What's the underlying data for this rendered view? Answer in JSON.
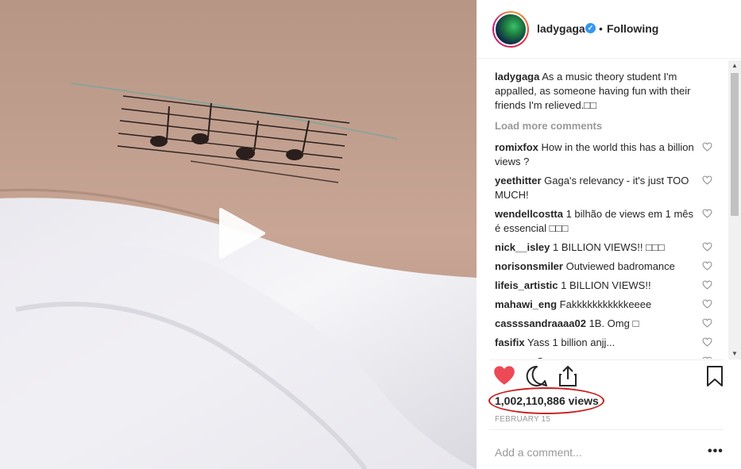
{
  "post": {
    "username": "ladygaga",
    "follow_status": "Following",
    "separator": "•",
    "verified_glyph": "✓",
    "caption_user": "ladygaga",
    "caption_text": "As a music theory student I'm appalled, as someone having fun with their friends I'm relieved.□□",
    "load_more": "Load more comments",
    "comments": [
      {
        "user": "romixfox",
        "text": "How in the world this has a billion views ?"
      },
      {
        "user": "yeethitter",
        "text": "Gaga's relevancy - it's just TOO MUCH!"
      },
      {
        "user": "wendellcostta",
        "text": "1 bilhão de views em 1 mês é essencial □□□"
      },
      {
        "user": "nick__isley",
        "text": "1 BILLION VIEWS!! □□□"
      },
      {
        "user": "norisonsmiler",
        "text": "Outviewed badromance"
      },
      {
        "user": "lifeis_artistic",
        "text": "1 BILLION VIEWS!!"
      },
      {
        "user": "mahawi_eng",
        "text": "Fakkkkkkkkkkkeeee"
      },
      {
        "user": "cassssandraaaa02",
        "text": "1B. Omg □"
      },
      {
        "user": "fasifix",
        "text": "Yass 1 billion anjj..."
      },
      {
        "user": "mm_orr",
        "text": "Omg"
      }
    ],
    "views": "1,002,110,886 views",
    "date": "FEBRUARY 15",
    "add_comment_placeholder": "Add a comment...",
    "more_glyph": "•••",
    "scroll_up": "▲",
    "scroll_down": "▼"
  },
  "icons": {
    "like": "heart-filled-icon",
    "comment": "comment-icon",
    "share": "share-icon",
    "save": "bookmark-icon",
    "play": "play-icon"
  },
  "colors": {
    "like_red": "#ed4956",
    "annotation_red": "#cc1b1b",
    "verified_blue": "#3897f0"
  }
}
